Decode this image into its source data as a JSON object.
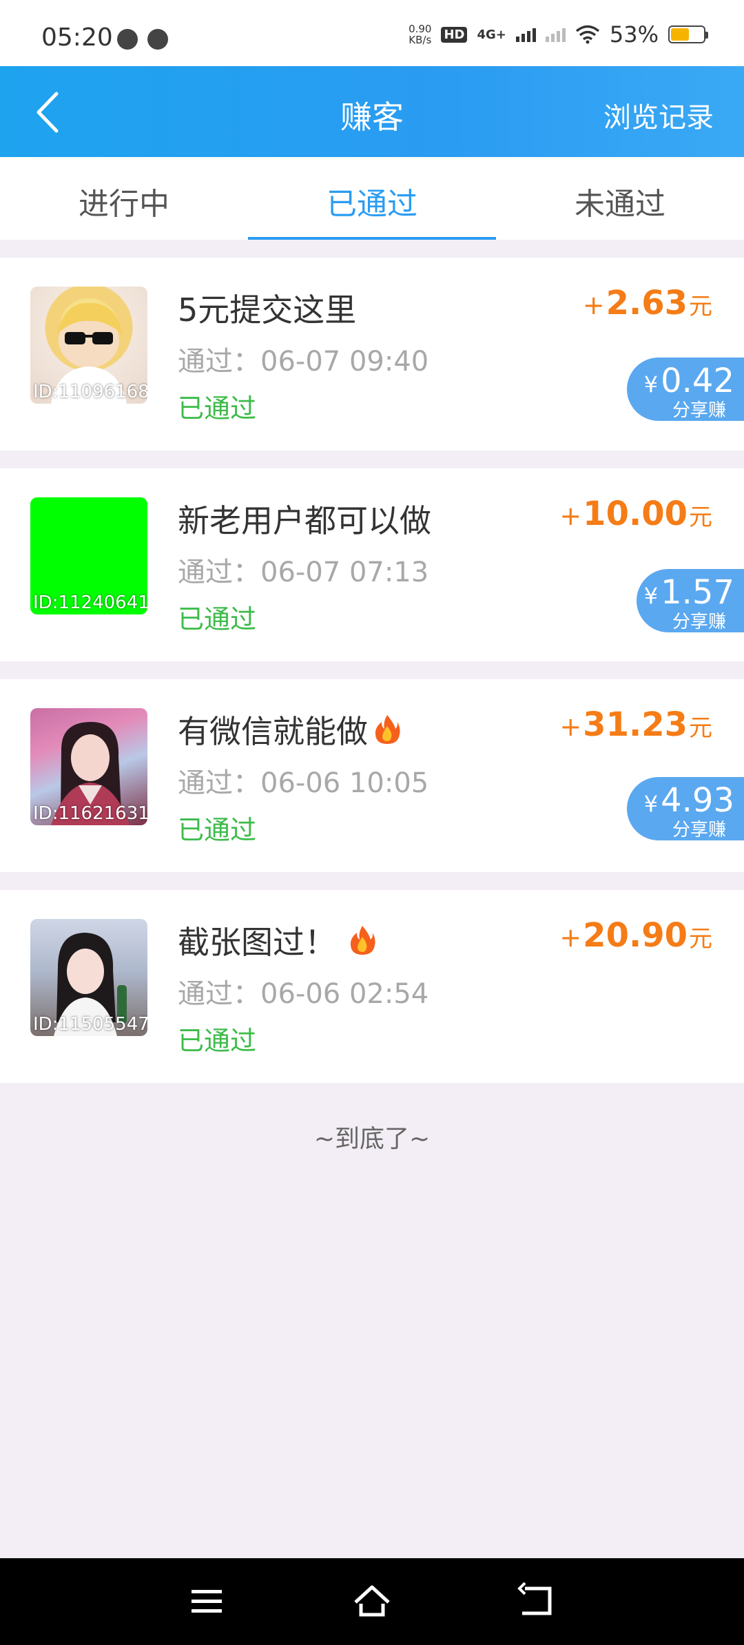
{
  "status_bar": {
    "time": "05:20",
    "net_speed_top": "0.90",
    "net_speed_bottom": "KB/s",
    "hd_label": "HD",
    "net_type": "4G+",
    "battery": "53%"
  },
  "header": {
    "title": "赚客",
    "right_link": "浏览记录"
  },
  "tabs": [
    {
      "label": "进行中"
    },
    {
      "label": "已通过"
    },
    {
      "label": "未通过"
    }
  ],
  "tasks": [
    {
      "title": "5元提交这里",
      "time": "通过：06-07 09:40",
      "status": "已通过",
      "id": "ID:11096168",
      "price_plus": "+",
      "price": "2.63",
      "unit": "元",
      "share_amount": "0.42",
      "share_label": "分享赚"
    },
    {
      "title": "新老用户都可以做",
      "time": "通过：06-07 07:13",
      "status": "已通过",
      "id": "ID:11240641",
      "price_plus": "+",
      "price": "10.00",
      "unit": "元",
      "share_amount": "1.57",
      "share_label": "分享赚"
    },
    {
      "title": "有微信就能做",
      "time": "通过：06-06 10:05",
      "status": "已通过",
      "id": "ID:11621631",
      "price_plus": "+",
      "price": "31.23",
      "unit": "元",
      "share_amount": "4.93",
      "share_label": "分享赚"
    },
    {
      "title": "截张图过！",
      "time": "通过：06-06 02:54",
      "status": "已通过",
      "id": "ID:11505547",
      "price_plus": "+",
      "price": "20.90",
      "unit": "元"
    }
  ],
  "yen_symbol": "¥",
  "end_text": "~到底了~",
  "colors": {
    "accent": "#2a9cf2",
    "price": "#f57c16",
    "status_green": "#3dbb4a",
    "share_badge": "#5aa8f0"
  }
}
